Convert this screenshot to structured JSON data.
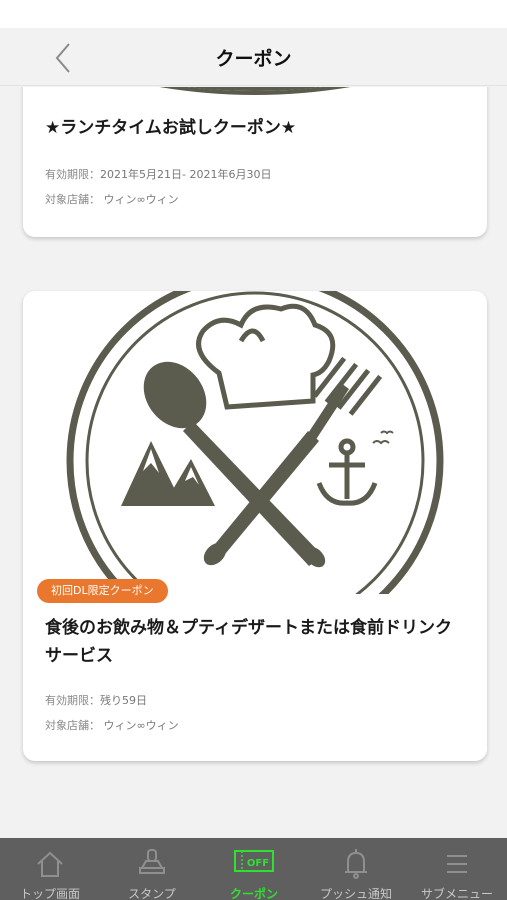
{
  "header": {
    "title": "クーポン"
  },
  "coupons": [
    {
      "title": "★ランチタイムお試しクーポン★",
      "period_label": "有効期限：",
      "period_value": "2021年5月21日- 2021年6月30日",
      "shop_label": "対象店舗：",
      "shop_value": "ウィン∞ウィン"
    },
    {
      "badge": "初回DL限定クーポン",
      "title": "食後のお飲み物＆プティデザートまたは食前ドリンクサービス",
      "period_label": "有効期限：",
      "period_value": "残り59日",
      "shop_label": "対象店舗：",
      "shop_value": "ウィン∞ウィン"
    }
  ],
  "tabbar": {
    "items": [
      {
        "label": "トップ画面",
        "icon": "home-icon"
      },
      {
        "label": "スタンプ",
        "icon": "stamp-icon"
      },
      {
        "label": "クーポン",
        "icon": "coupon-off-icon",
        "icon_text": "OFF",
        "active": true
      },
      {
        "label": "プッシュ通知",
        "icon": "bell-icon"
      },
      {
        "label": "サブメニュー",
        "icon": "menu-icon"
      }
    ]
  },
  "colors": {
    "accent": "#2fe02f",
    "badge": "#e9772e",
    "logo": "#5b5b4e",
    "tabbar": "#5f5f5f"
  }
}
